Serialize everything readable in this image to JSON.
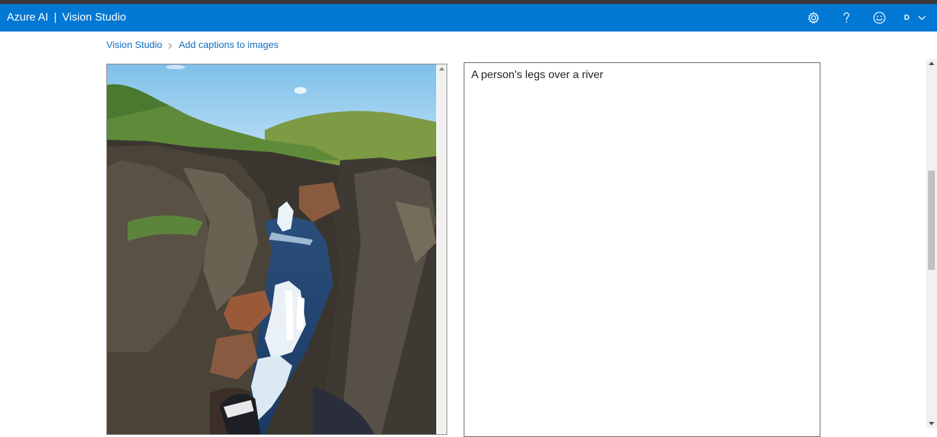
{
  "header": {
    "brand": "Azure AI",
    "separator": "|",
    "product": "Vision Studio",
    "icons": [
      "gear-icon",
      "help-icon",
      "smiley-feedback-icon"
    ],
    "avatar_initial": "D",
    "colors": {
      "bar": "#0078d4",
      "top_strip": "#3b3a39"
    }
  },
  "breadcrumb": {
    "items": [
      {
        "label": "Vision Studio"
      },
      {
        "label": "Add captions to images"
      }
    ],
    "link_color": "#0f6cbd"
  },
  "image_panel": {
    "image": "photo of a rocky canyon with waterfalls and a person's legs in the foreground"
  },
  "caption_panel": {
    "caption": "A person's legs over a river"
  }
}
